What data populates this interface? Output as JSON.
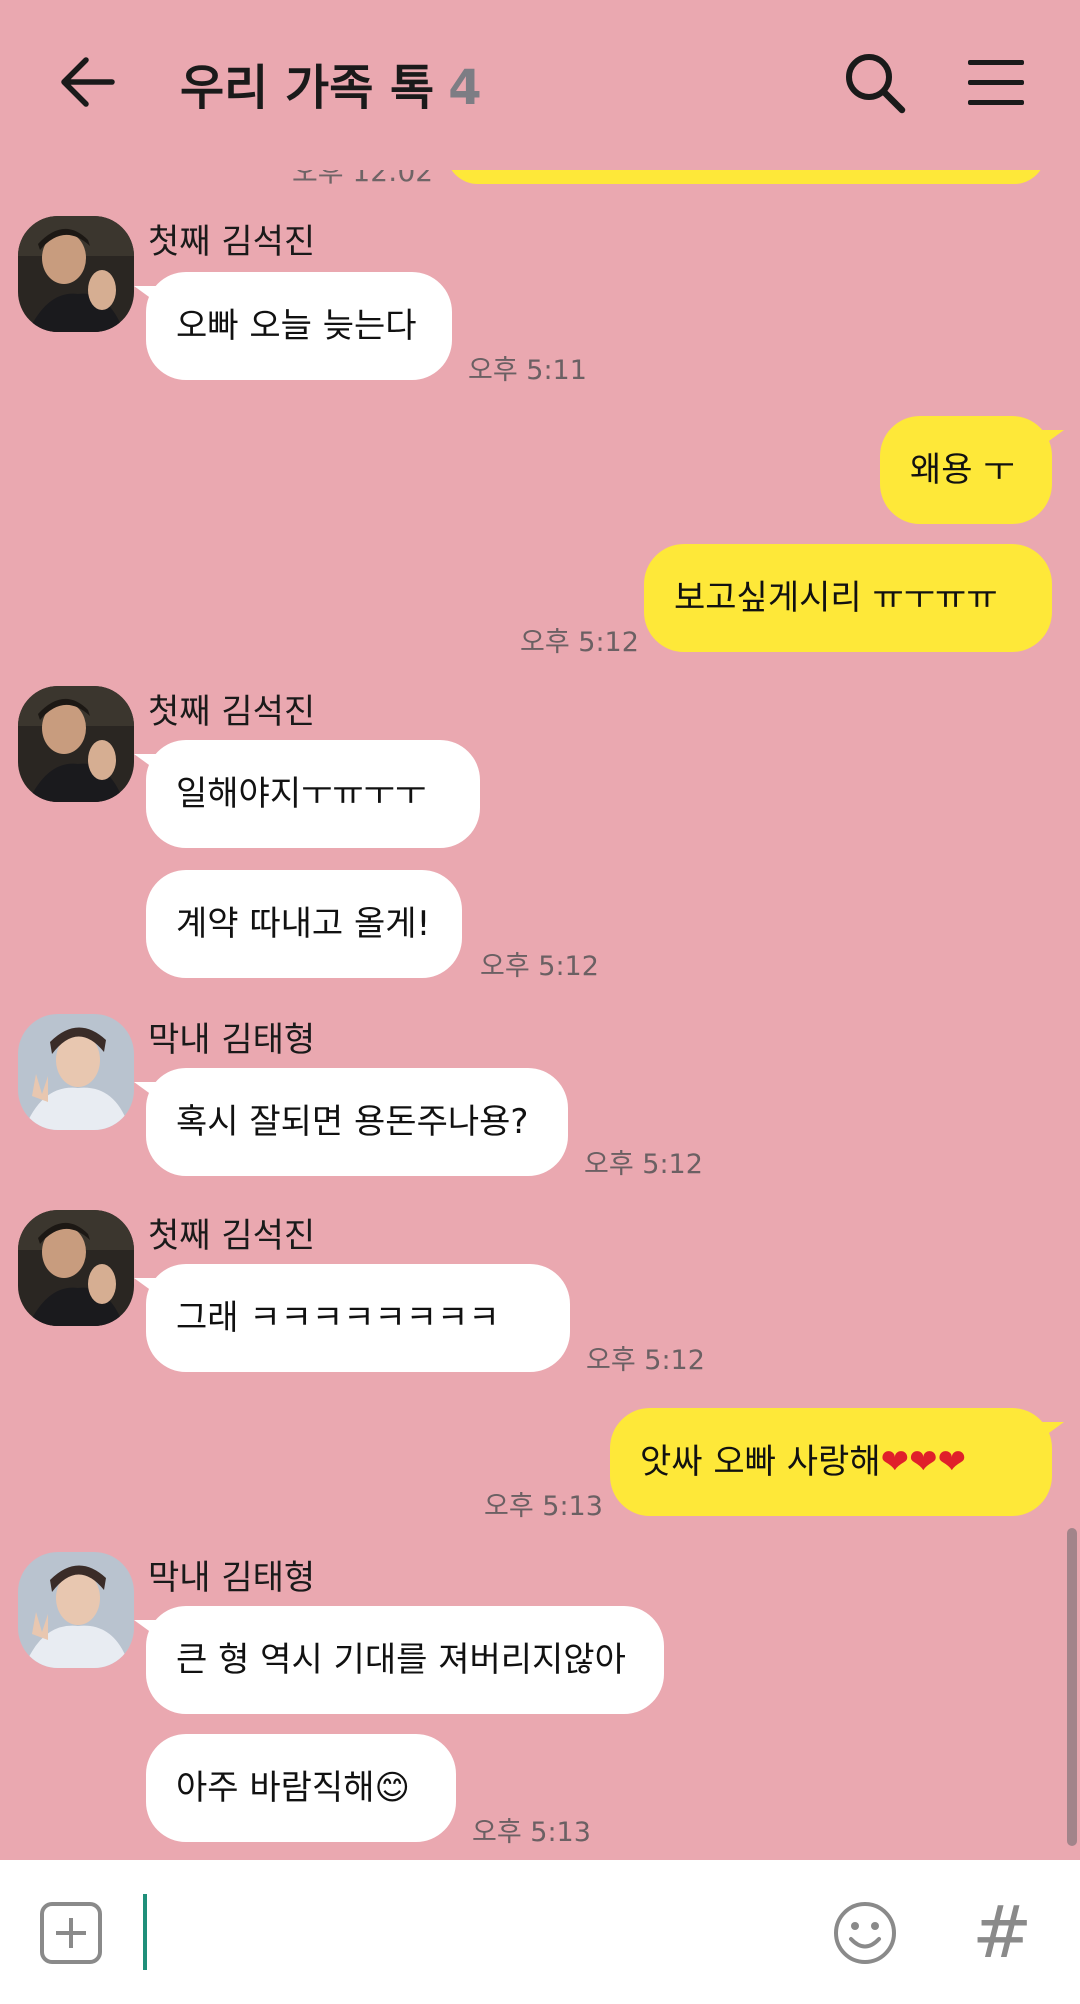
{
  "header": {
    "title": "우리 가족 톡",
    "member_count": "4"
  },
  "chat": {
    "top_cut_time": "오후 12:02",
    "senders": {
      "seokjin": "첫째 김석진",
      "taehyung": "막내 김태형"
    },
    "messages": [
      {
        "text": "오빠 오늘 늦는다",
        "time": "오후 5:11"
      },
      {
        "text": "왜용 ㅜ"
      },
      {
        "text": "보고싶게시리 ㅠㅜㅠㅠ",
        "time": "오후 5:12"
      },
      {
        "text": "일해야지ㅜㅠㅜㅜ"
      },
      {
        "text": "계약 따내고 올게!",
        "time": "오후 5:12"
      },
      {
        "text": "혹시 잘되면 용돈주나용?",
        "time": "오후 5:12"
      },
      {
        "text": "그래 ㅋㅋㅋㅋㅋㅋㅋㅋ",
        "time": "오후 5:12"
      },
      {
        "text": "앗싸 오빠 사랑해❤❤❤",
        "time": "오후 5:13"
      },
      {
        "text": "큰 형 역시 기대를 져버리지않아"
      },
      {
        "text": "아주 바람직해😊",
        "time": "오후 5:13"
      }
    ]
  },
  "input": {
    "placeholder": "",
    "hash_label": "#"
  },
  "colors": {
    "background": "#eaa8b0",
    "my_bubble": "#fee839",
    "their_bubble": "#ffffff",
    "heart": "#e0202a",
    "caret": "#1f8f7a"
  },
  "icons": [
    "back-arrow-icon",
    "search-icon",
    "menu-icon",
    "plus-icon",
    "emoji-icon",
    "hash-icon"
  ]
}
